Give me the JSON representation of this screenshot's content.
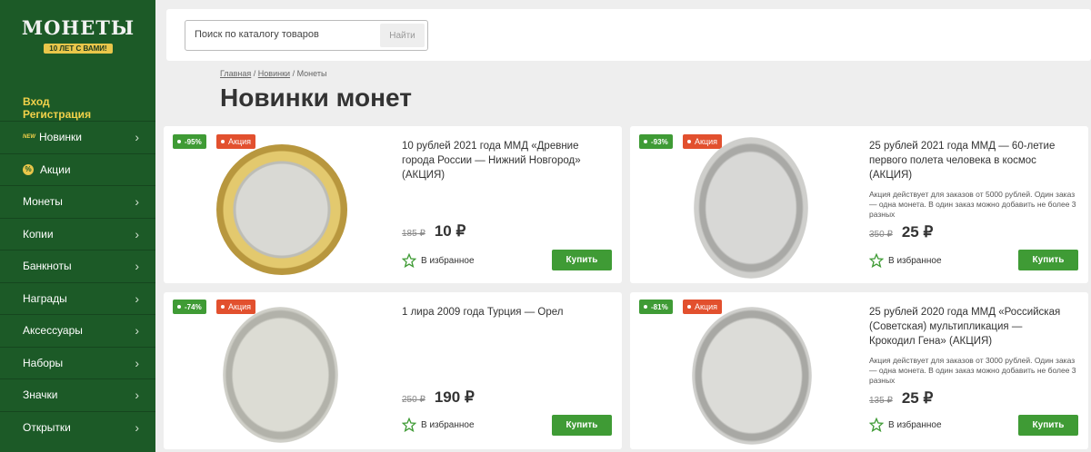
{
  "logo": {
    "title": "МОНЕТЫ",
    "subtitle": "10 ЛЕТ С ВАМИ!"
  },
  "auth": {
    "login": "Вход",
    "register": "Регистрация"
  },
  "nav": [
    {
      "label": "Новинки",
      "badge": "NEW"
    },
    {
      "label": "Акции",
      "badge": "%"
    },
    {
      "label": "Монеты"
    },
    {
      "label": "Копии"
    },
    {
      "label": "Банкноты"
    },
    {
      "label": "Награды"
    },
    {
      "label": "Аксессуары"
    },
    {
      "label": "Наборы"
    },
    {
      "label": "Значки"
    },
    {
      "label": "Открытки"
    }
  ],
  "search": {
    "placeholder": "Поиск по каталогу товаров",
    "button": "Найти"
  },
  "breadcrumb": {
    "home": "Главная",
    "news": "Новинки",
    "current": "Монеты"
  },
  "page_title": "Новинки монет",
  "common": {
    "sale_label": "Акция",
    "fav_label": "В избранное",
    "buy_label": "Купить",
    "currency": "₽"
  },
  "products": [
    {
      "discount": "-95%",
      "title": "10 рублей 2021 года ММД «Древние города России — Нижний Новгород» (АКЦИЯ)",
      "note": "",
      "old_price": "185",
      "price": "10"
    },
    {
      "discount": "-93%",
      "title": "25 рублей 2021 года ММД — 60-летие первого полета человека в космос (АКЦИЯ)",
      "note": "Акция действует для заказов от 5000 рублей. Один заказ — одна монета. В один заказ можно добавить не более 3 разных",
      "old_price": "350",
      "price": "25"
    },
    {
      "discount": "-74%",
      "title": "1 лира 2009 года Турция — Орел",
      "note": "",
      "old_price": "250",
      "price": "190"
    },
    {
      "discount": "-81%",
      "title": "25 рублей 2020 года ММД «Российская (Советская) мультипликация — Крокодил Гена» (АКЦИЯ)",
      "note": "Акция действует для заказов от 3000 рублей. Один заказ — одна монета. В один заказ можно добавить не более 3 разных",
      "old_price": "135",
      "price": "25"
    }
  ],
  "colors": {
    "sidebar": "#1c5a27",
    "accent_green": "#3f9b35",
    "sale_red": "#e2502e",
    "gold": "#f2d24a"
  }
}
